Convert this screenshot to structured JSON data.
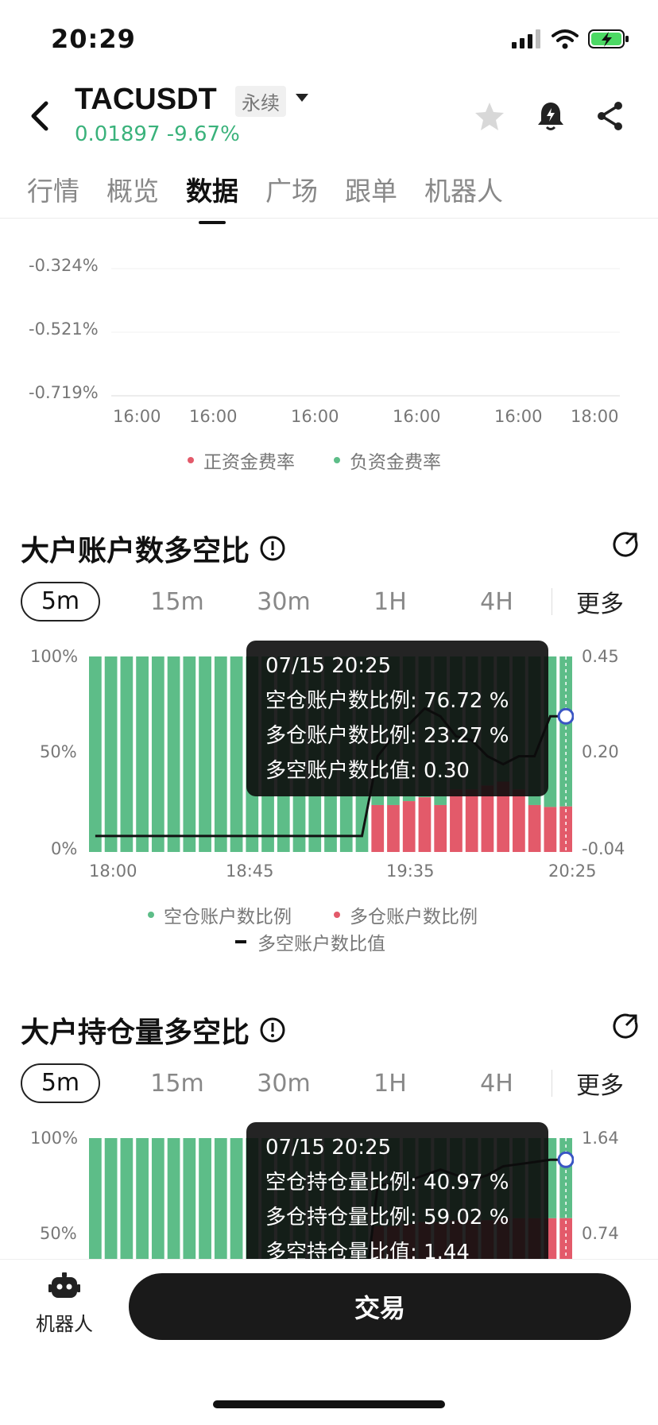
{
  "status_bar": {
    "time": "20:29"
  },
  "header": {
    "pair": "TACUSDT",
    "badge": "永续",
    "price": "0.01897",
    "change": "-9.67%"
  },
  "tabs": [
    {
      "label": "行情"
    },
    {
      "label": "概览"
    },
    {
      "label": "数据",
      "active": true
    },
    {
      "label": "广场"
    },
    {
      "label": "跟单"
    },
    {
      "label": "机器人"
    }
  ],
  "colors": {
    "green": "#5dbd88",
    "red": "#e35a6a",
    "up": "#3ab27b"
  },
  "funding_chart": {
    "y_ticks": [
      "-0.324%",
      "-0.521%",
      "-0.719%"
    ],
    "x_ticks": [
      "16:00",
      "16:00",
      "16:00",
      "16:00",
      "16:00",
      "18:00"
    ],
    "legend": [
      "正资金费率",
      "负资金费率"
    ]
  },
  "section1": {
    "title": "大户账户数多空比",
    "periods": [
      "5m",
      "15m",
      "30m",
      "1H",
      "4H"
    ],
    "more": "更多",
    "tooltip": {
      "time": "07/15 20:25",
      "line1": "空仓账户数比例: 76.72 %",
      "line2": "多仓账户数比例: 23.27 %",
      "line3": "多空账户数比值: 0.30"
    },
    "legend": [
      "空仓账户数比例",
      "多仓账户数比例",
      "多空账户数比值"
    ]
  },
  "section2": {
    "title": "大户持仓量多空比",
    "periods": [
      "5m",
      "15m",
      "30m",
      "1H",
      "4H"
    ],
    "more": "更多",
    "tooltip": {
      "time": "07/15 20:25",
      "line1": "空仓持仓量比例: 40.97 %",
      "line2": "多仓持仓量比例: 59.02 %",
      "line3": "多空持仓量比值: 1.44"
    }
  },
  "chart_data": [
    {
      "type": "bar",
      "title": "大户账户数多空比",
      "x_tick_labels": [
        "18:00",
        "18:45",
        "19:35",
        "20:25"
      ],
      "y_left_ticks": [
        "100%",
        "50%",
        "0%"
      ],
      "y_right_ticks": [
        "0.45",
        "0.20",
        "-0.04"
      ],
      "ylim_left": [
        0,
        100
      ],
      "ylim_right": [
        -0.04,
        0.45
      ],
      "series": [
        {
          "name": "空仓账户数比例",
          "color": "#5dbd88",
          "values": [
            100,
            100,
            100,
            100,
            100,
            100,
            100,
            100,
            100,
            100,
            100,
            100,
            100,
            100,
            100,
            100,
            100,
            100,
            76,
            76,
            74,
            72,
            76,
            68,
            68,
            66,
            64,
            68,
            76,
            77,
            76.72
          ]
        },
        {
          "name": "多仓账户数比例",
          "color": "#e35a6a",
          "values": [
            0,
            0,
            0,
            0,
            0,
            0,
            0,
            0,
            0,
            0,
            0,
            0,
            0,
            0,
            0,
            0,
            0,
            0,
            24,
            24,
            26,
            28,
            24,
            32,
            32,
            34,
            36,
            32,
            24,
            23,
            23.27
          ]
        },
        {
          "name": "多空账户数比值",
          "color": "#111111",
          "kind": "line",
          "values": [
            0,
            0,
            0,
            0,
            0,
            0,
            0,
            0,
            0,
            0,
            0,
            0,
            0,
            0,
            0,
            0,
            0,
            0,
            0.2,
            0.25,
            0.28,
            0.32,
            0.3,
            0.25,
            0.24,
            0.2,
            0.18,
            0.2,
            0.2,
            0.3,
            0.3
          ]
        }
      ]
    },
    {
      "type": "bar",
      "title": "大户持仓量多空比",
      "y_left_ticks": [
        "100%",
        "50%"
      ],
      "y_right_ticks": [
        "1.64",
        "0.74"
      ],
      "ylim_left": [
        0,
        100
      ],
      "ylim_right": [
        -0.16,
        1.64
      ],
      "series": [
        {
          "name": "空仓持仓量比例",
          "color": "#5dbd88",
          "values": [
            100,
            100,
            100,
            100,
            100,
            100,
            100,
            100,
            100,
            100,
            100,
            100,
            100,
            100,
            100,
            100,
            100,
            100,
            45,
            45,
            44,
            43,
            43,
            42,
            42,
            42,
            41,
            41,
            41,
            41,
            40.97
          ]
        },
        {
          "name": "多仓持仓量比例",
          "color": "#e35a6a",
          "values": [
            0,
            0,
            0,
            0,
            0,
            0,
            0,
            0,
            0,
            0,
            0,
            0,
            0,
            0,
            0,
            0,
            0,
            0,
            55,
            55,
            56,
            57,
            57,
            58,
            58,
            58,
            59,
            59,
            59,
            59,
            59.02
          ]
        },
        {
          "name": "多空持仓量比值",
          "color": "#111111",
          "kind": "line",
          "values": [
            0,
            0,
            0,
            0,
            0,
            0,
            0,
            0,
            0,
            0,
            0,
            0,
            0,
            0,
            0,
            0,
            0,
            0,
            1.2,
            1.22,
            1.25,
            1.3,
            1.35,
            1.3,
            1.25,
            1.3,
            1.38,
            1.4,
            1.42,
            1.44,
            1.44
          ]
        }
      ]
    }
  ],
  "bottom": {
    "robot_label": "机器人",
    "trade_label": "交易"
  }
}
